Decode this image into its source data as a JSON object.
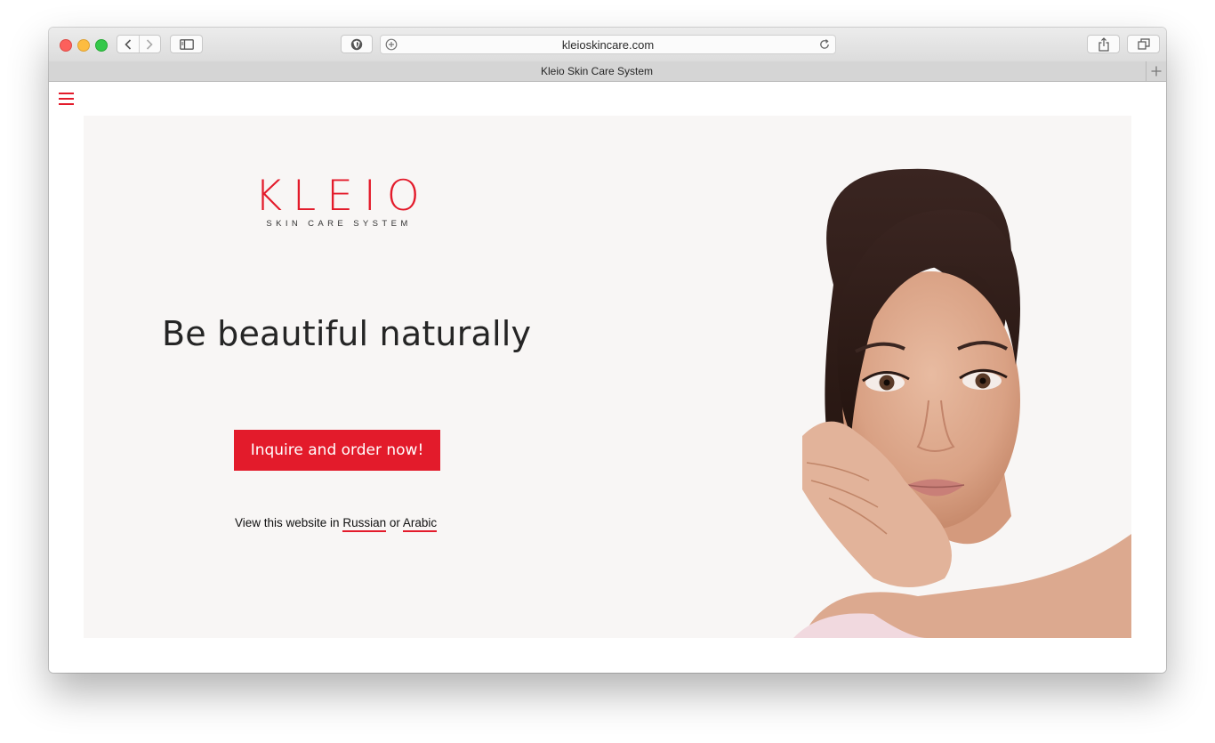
{
  "browser": {
    "url": "kleioskincare.com",
    "tab_title": "Kleio Skin Care System"
  },
  "brand": {
    "name": "KLEIO",
    "tagline": "SKIN CARE SYSTEM",
    "accent_color": "#e31b2b"
  },
  "hero": {
    "headline": "Be beautiful naturally",
    "cta_label": "Inquire and order now!",
    "language_prefix": "View this website in",
    "language_options": [
      "Russian",
      "Arabic"
    ],
    "language_joiner": "or"
  },
  "icons": {
    "menu": "hamburger-menu-icon",
    "back": "chevron-left-icon",
    "forward": "chevron-right-icon",
    "sidebar": "sidebar-icon",
    "privacy": "shield-icon",
    "add_bookmark": "plus-circle-icon",
    "reload": "reload-icon",
    "share": "share-icon",
    "tabs": "tabs-overview-icon",
    "new_tab": "plus-icon"
  }
}
